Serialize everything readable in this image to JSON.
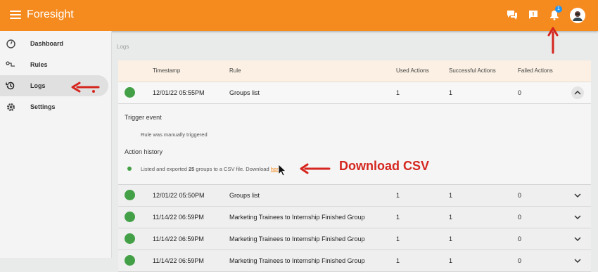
{
  "app": {
    "title": "Foresight",
    "notification_count": "1"
  },
  "sidebar": {
    "items": [
      {
        "label": "Dashboard",
        "icon": "dashboard-icon"
      },
      {
        "label": "Rules",
        "icon": "rules-icon"
      },
      {
        "label": "Logs",
        "icon": "history-icon",
        "active": true
      },
      {
        "label": "Settings",
        "icon": "gear-icon"
      }
    ]
  },
  "breadcrumb": "Logs",
  "table": {
    "headers": [
      "Timestamp",
      "Rule",
      "Used Actions",
      "Successful Actions",
      "Failed Actions"
    ],
    "rows": [
      {
        "timestamp": "12/01/22 05:55PM",
        "rule": "Groups list",
        "used": "1",
        "successful": "1",
        "failed": "0"
      },
      {
        "timestamp": "12/01/22 05:50PM",
        "rule": "Groups list",
        "used": "1",
        "successful": "1",
        "failed": "0"
      },
      {
        "timestamp": "11/14/22 06:59PM",
        "rule": "Marketing Trainees to Internship Finished Group",
        "used": "1",
        "successful": "1",
        "failed": "0"
      },
      {
        "timestamp": "11/14/22 06:59PM",
        "rule": "Marketing Trainees to Internship Finished Group",
        "used": "1",
        "successful": "1",
        "failed": "0"
      },
      {
        "timestamp": "11/14/22 06:59PM",
        "rule": "Marketing Trainees to Internship Finished Group",
        "used": "1",
        "successful": "1",
        "failed": "0"
      }
    ]
  },
  "detail": {
    "trigger_heading": "Trigger event",
    "trigger_text": "Rule was manually triggered",
    "action_heading": "Action history",
    "action_text_before": "Listed and exported",
    "action_count": "25",
    "action_text_after": "groups to a CSV file. Download",
    "link_text": "here"
  },
  "annotation": {
    "callout": "Download CSV",
    "color": "#d5261f"
  },
  "colors": {
    "brand": "#f58a1f",
    "success": "#43a047",
    "badge": "#2196f3"
  }
}
